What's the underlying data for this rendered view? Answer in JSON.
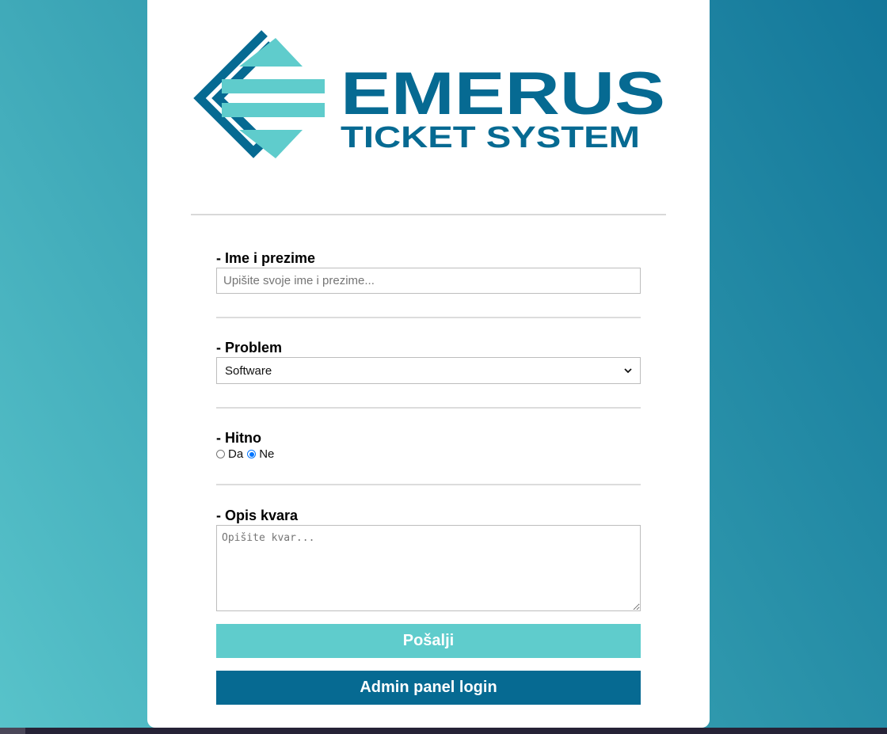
{
  "colors": {
    "accent_light": "#5fcccc",
    "accent_dark": "#066a92",
    "divider": "#dcdcdc"
  },
  "logo": {
    "brand": "EMERUS",
    "tagline": "TICKET SYSTEM",
    "icon": "emerus-diamond-logo-icon"
  },
  "form": {
    "name": {
      "label": "- Ime i prezime",
      "placeholder": "Upišite svoje ime i prezime...",
      "value": ""
    },
    "problem": {
      "label": "- Problem",
      "selected": "Software"
    },
    "urgent": {
      "label": "- Hitno",
      "options": [
        {
          "label": "Da",
          "checked": false
        },
        {
          "label": "Ne",
          "checked": true
        }
      ]
    },
    "description": {
      "label": "- Opis kvara",
      "placeholder": "Opišite kvar..."
    },
    "submit_label": "Pošalji",
    "admin_label": "Admin panel login"
  }
}
